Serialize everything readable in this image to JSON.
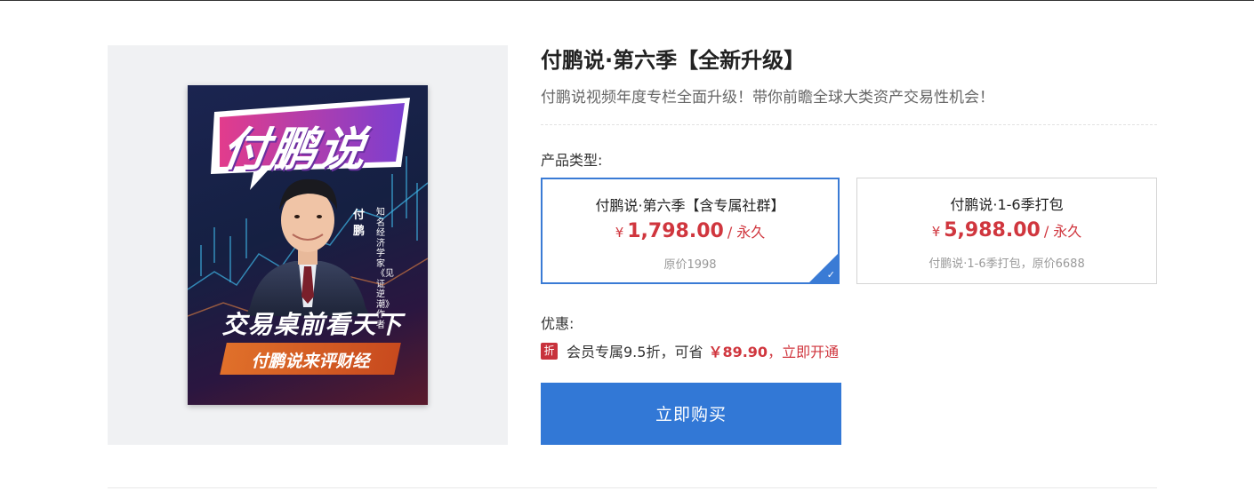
{
  "product": {
    "title": "付鹏说·第六季【全新升级】",
    "subtitle": "付鹏说视频年度专栏全面升级！带你前瞻全球大类资产交易性机会！"
  },
  "cover": {
    "brand": "付鹏说",
    "person_name": "付鹏",
    "person_title": "知名经济学家《见证逆潮》作者",
    "slogan_main": "交易桌前看天下",
    "slogan_sub": "付鹏说来评财经"
  },
  "product_type": {
    "label": "产品类型:",
    "options": [
      {
        "name": "付鹏说·第六季【含专属社群】",
        "currency": "¥",
        "price": "1,798.00",
        "period": "/ 永久",
        "note": "原价1998",
        "selected": true
      },
      {
        "name": "付鹏说·1-6季打包",
        "currency": "¥",
        "price": "5,988.00",
        "period": "/ 永久",
        "note": "付鹏说·1-6季打包，原价6688",
        "selected": false
      }
    ]
  },
  "discount": {
    "label": "优惠:",
    "badge": "折",
    "text": "会员专属9.5折，可省",
    "amount": "￥89.90",
    "separator": "，",
    "link": "立即开通"
  },
  "buy_button": {
    "label": "立即购买"
  },
  "colors": {
    "accent": "#3278d6",
    "price": "#d0363e",
    "panel_bg": "#f0f1f3"
  }
}
